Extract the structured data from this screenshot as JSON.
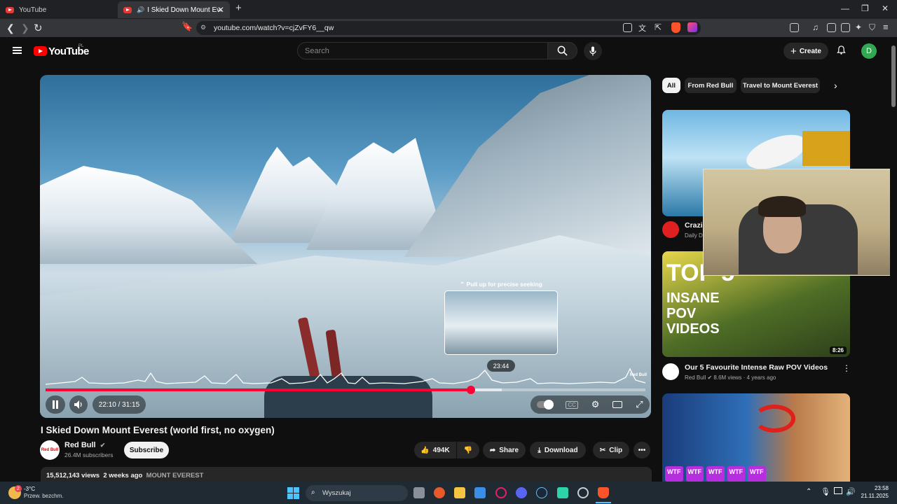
{
  "browser": {
    "tabs": [
      {
        "label": "YouTube"
      },
      {
        "label": "I Skied Down Mount Everest ("
      }
    ],
    "url": "youtube.com/watch?v=cjZvFY6__qw"
  },
  "masthead": {
    "logo": "YouTube",
    "country": "PL",
    "search_placeholder": "Search",
    "create_label": "Create",
    "avatar_letter": "D"
  },
  "player": {
    "seek_hint": "Pull up for precise seeking",
    "hover_time": "23:44",
    "current_time": "22:10",
    "duration": "31:15",
    "time_label": "22:10 / 31:15",
    "progress": 0.709,
    "buffered": 0.76,
    "watermark": "Red Bull"
  },
  "video": {
    "title": "I Skied Down Mount Everest (world first, no oxygen)",
    "channel": "Red Bull",
    "subscribers": "26.4M subscribers",
    "subscribe_label": "Subscribe",
    "likes": "494K",
    "share_label": "Share",
    "download_label": "Download",
    "clip_label": "Clip",
    "views": "15,512,143 views",
    "age": "2 weeks ago",
    "tag": "MOUNT EVEREST"
  },
  "sidebar": {
    "chips": [
      {
        "label": "All"
      },
      {
        "label": "From Red Bull"
      },
      {
        "label": "Travel to Mount Everest"
      }
    ],
    "recs": [
      {
        "title": "Crazi",
        "channel": "Daily D"
      },
      {
        "title": "Our 5 Favourite Intense Raw POV Videos",
        "channel": "Red Bull",
        "meta": "8.6M views · 4 years ago",
        "duration": "8:26",
        "thumb_text": [
          "TOP 5",
          "INSANE",
          "POV",
          "VIDEOS"
        ]
      },
      {
        "title": "",
        "thumb_text": [
          "WTF",
          "WTF",
          "WTF",
          "WTF",
          "WTF"
        ]
      }
    ]
  },
  "taskbar": {
    "temperature": "-3°C",
    "weather": "Przew. bezchm.",
    "search": "Wyszukaj",
    "time": "23:58",
    "date": "21.11.2025",
    "badge": "2"
  },
  "colors": {
    "accent": "#ff0033",
    "background": "#0f0f0f",
    "avatar": "#33a852"
  }
}
